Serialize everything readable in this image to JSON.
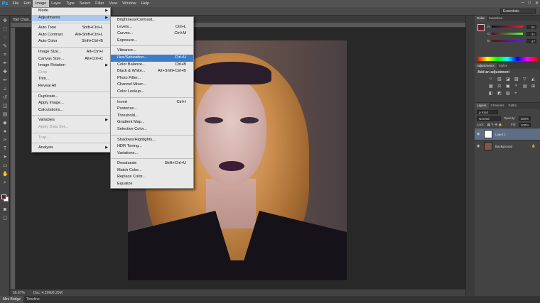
{
  "menubar": {
    "logo": "Ps",
    "items": [
      "File",
      "Edit",
      "Image",
      "Layer",
      "Type",
      "Select",
      "Filter",
      "View",
      "Window",
      "Help"
    ],
    "active": "Image"
  },
  "optbar": {
    "workspace": "Essentials"
  },
  "document": {
    "tab_title": "Hair Chan..."
  },
  "status": {
    "zoom": "66.67%",
    "doc": "Doc: 4.29M/8.29M"
  },
  "bottom_tabs": [
    "Mini Bridge",
    "Timeline"
  ],
  "image_menu": {
    "groups": [
      [
        {
          "label": "Mode",
          "arrow": true
        },
        {
          "label": "Adjustments",
          "arrow": true,
          "state": "hl-light"
        }
      ],
      [
        {
          "label": "Auto Tone",
          "shortcut": "Shift+Ctrl+L"
        },
        {
          "label": "Auto Contrast",
          "shortcut": "Alt+Shift+Ctrl+L"
        },
        {
          "label": "Auto Color",
          "shortcut": "Shift+Ctrl+B"
        }
      ],
      [
        {
          "label": "Image Size...",
          "shortcut": "Alt+Ctrl+I"
        },
        {
          "label": "Canvas Size...",
          "shortcut": "Alt+Ctrl+C"
        },
        {
          "label": "Image Rotation",
          "arrow": true
        },
        {
          "label": "Crop",
          "state": "dis"
        },
        {
          "label": "Trim..."
        },
        {
          "label": "Reveal All"
        }
      ],
      [
        {
          "label": "Duplicate..."
        },
        {
          "label": "Apply Image..."
        },
        {
          "label": "Calculations..."
        }
      ],
      [
        {
          "label": "Variables",
          "arrow": true
        },
        {
          "label": "Apply Data Set...",
          "state": "dis"
        }
      ],
      [
        {
          "label": "Trap...",
          "state": "dis"
        }
      ],
      [
        {
          "label": "Analysis",
          "arrow": true
        }
      ]
    ]
  },
  "adjustments_menu": {
    "groups": [
      [
        {
          "label": "Brightness/Contrast..."
        },
        {
          "label": "Levels...",
          "shortcut": "Ctrl+L"
        },
        {
          "label": "Curves...",
          "shortcut": "Ctrl+M"
        },
        {
          "label": "Exposure..."
        }
      ],
      [
        {
          "label": "Vibrance..."
        },
        {
          "label": "Hue/Saturation...",
          "shortcut": "Ctrl+U",
          "state": "hl"
        },
        {
          "label": "Color Balance...",
          "shortcut": "Ctrl+B"
        },
        {
          "label": "Black & White...",
          "shortcut": "Alt+Shift+Ctrl+B"
        },
        {
          "label": "Photo Filter..."
        },
        {
          "label": "Channel Mixer..."
        },
        {
          "label": "Color Lookup..."
        }
      ],
      [
        {
          "label": "Invert",
          "shortcut": "Ctrl+I"
        },
        {
          "label": "Posterize..."
        },
        {
          "label": "Threshold..."
        },
        {
          "label": "Gradient Map..."
        },
        {
          "label": "Selective Color..."
        }
      ],
      [
        {
          "label": "Shadows/Highlights..."
        },
        {
          "label": "HDR Toning..."
        },
        {
          "label": "Variations..."
        }
      ],
      [
        {
          "label": "Desaturate",
          "shortcut": "Shift+Ctrl+U"
        },
        {
          "label": "Match Color..."
        },
        {
          "label": "Replace Color..."
        },
        {
          "label": "Equalize"
        }
      ]
    ]
  },
  "color_panel": {
    "tabs": [
      "Color",
      "Swatches"
    ],
    "foreground": "#6b1a2b",
    "channels": [
      {
        "label": "R",
        "value": "91"
      },
      {
        "label": "G",
        "value": "21"
      },
      {
        "label": "B",
        "value": "47"
      }
    ]
  },
  "adjustments_panel": {
    "tabs": [
      "Adjustments",
      "Styles"
    ],
    "title": "Add an adjustment",
    "icons": [
      "☼",
      "▥",
      "◪",
      "▨",
      "▽",
      "◭",
      "▦",
      "⚖",
      "▣",
      "◑",
      "▤",
      "⊞",
      "◧",
      "◩",
      "▧",
      "◒"
    ]
  },
  "layers_panel": {
    "tabs": [
      "Layers",
      "Channels",
      "Paths"
    ],
    "filter": "Kind",
    "blend_mode": "Normal",
    "opacity_label": "Opacity:",
    "opacity": "100%",
    "lock_label": "Lock:",
    "fill_label": "Fill:",
    "fill": "100%",
    "layers": [
      {
        "name": "Layer 1",
        "selected": true
      },
      {
        "name": "Background",
        "selected": false
      }
    ]
  }
}
